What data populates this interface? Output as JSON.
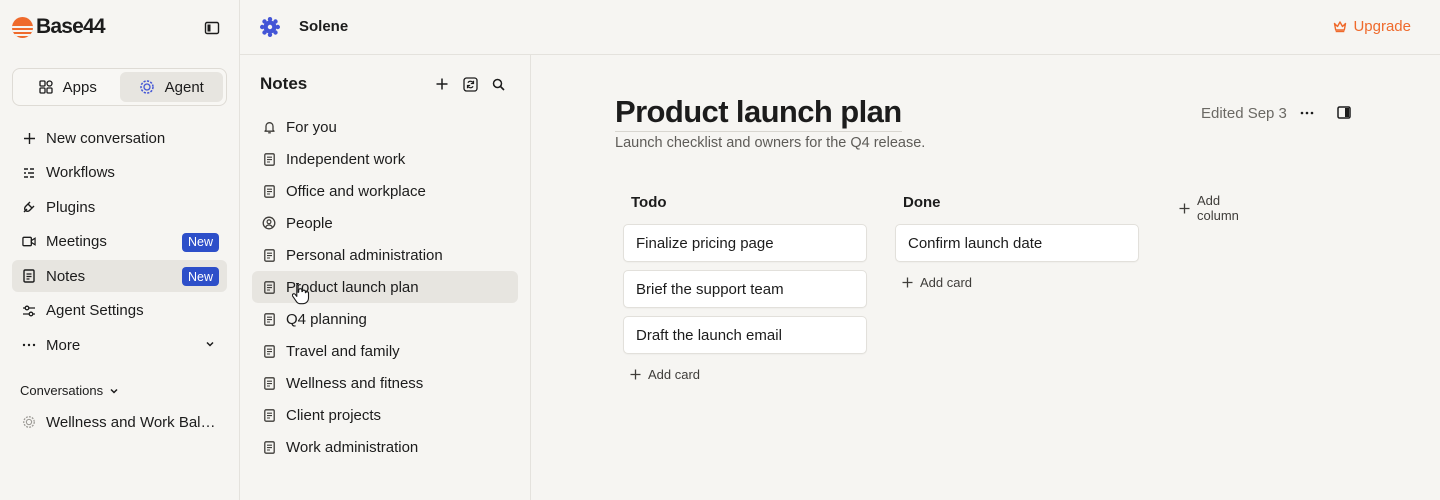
{
  "brand": {
    "name": "Base44",
    "color": "#ef6a2c"
  },
  "sidebar": {
    "mode_switch": [
      {
        "label": "Apps",
        "icon": "apps-icon"
      },
      {
        "label": "Agent",
        "icon": "agent-icon",
        "active": true
      }
    ],
    "nav": [
      {
        "label": "New conversation",
        "icon": "plus-icon"
      },
      {
        "label": "Workflows",
        "icon": "workflows-icon"
      },
      {
        "label": "Plugins",
        "icon": "plug-icon"
      },
      {
        "label": "Meetings",
        "icon": "video-icon",
        "badge": "New"
      },
      {
        "label": "Notes",
        "icon": "notes-icon",
        "badge": "New",
        "active": true
      },
      {
        "label": "Agent Settings",
        "icon": "sliders-icon"
      },
      {
        "label": "More",
        "icon": "more-icon"
      }
    ],
    "conversations_label": "Conversations",
    "conversations": [
      {
        "label": "Wellness and Work Balance"
      }
    ]
  },
  "topbar": {
    "workspace": "Solene",
    "upgrade_label": "Upgrade",
    "accent": "#ef6a2c"
  },
  "notes_panel": {
    "title": "Notes",
    "items": [
      {
        "label": "For you",
        "icon": "bell-icon"
      },
      {
        "label": "Independent work",
        "icon": "document-icon"
      },
      {
        "label": "Office and workplace",
        "icon": "document-icon"
      },
      {
        "label": "People",
        "icon": "person-icon"
      },
      {
        "label": "Personal administration",
        "icon": "document-icon"
      },
      {
        "label": "Product launch plan",
        "icon": "document-icon",
        "active": true
      },
      {
        "label": "Q4 planning",
        "icon": "document-icon"
      },
      {
        "label": "Travel and family",
        "icon": "document-icon"
      },
      {
        "label": "Wellness and fitness",
        "icon": "document-icon"
      },
      {
        "label": "Client projects",
        "icon": "document-icon"
      },
      {
        "label": "Work administration",
        "icon": "document-icon"
      }
    ]
  },
  "document": {
    "title": "Product launch plan",
    "subtitle": "Launch checklist and owners for the Q4 release.",
    "edited": "Edited Sep 3",
    "board": {
      "columns": [
        {
          "title": "Todo",
          "cards": [
            "Finalize pricing page",
            "Brief the support team",
            "Draft the launch email"
          ],
          "add_card_label": "Add card"
        },
        {
          "title": "Done",
          "cards": [
            "Confirm launch date"
          ],
          "add_card_label": "Add card"
        }
      ],
      "add_column_label": "Add column"
    }
  },
  "badge_color": "#2d4fc9"
}
